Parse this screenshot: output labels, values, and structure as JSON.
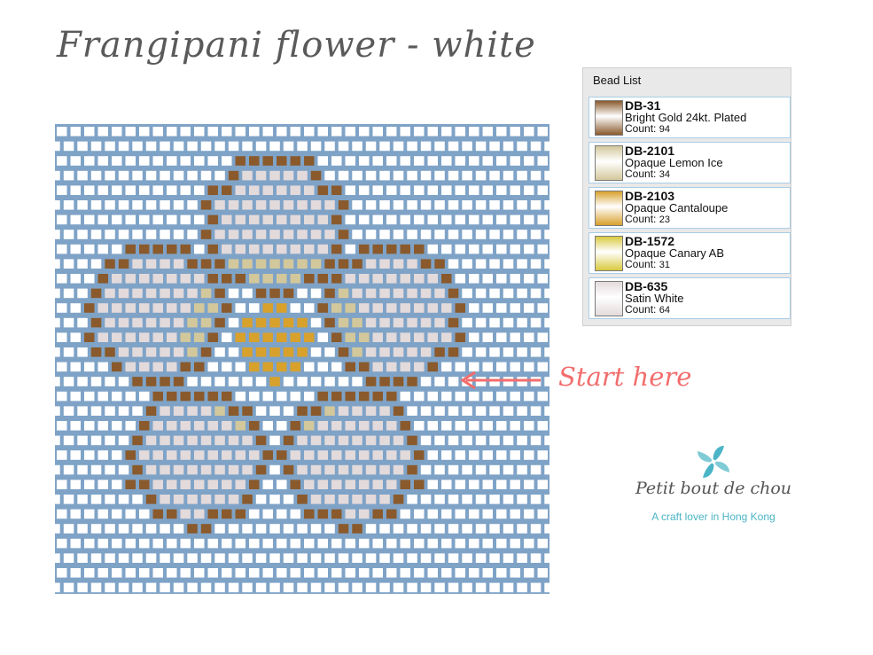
{
  "title": "Frangipani flower - white",
  "bead_list": {
    "header": "Bead List",
    "count_label": "Count:",
    "items": [
      {
        "code": "DB-31",
        "name": "Bright Gold 24kt. Plated",
        "count": "94",
        "color": "#8a5a2c"
      },
      {
        "code": "DB-2101",
        "name": "Opaque Lemon Ice",
        "count": "34",
        "color": "#d3c89b"
      },
      {
        "code": "DB-2103",
        "name": "Opaque Cantaloupe",
        "count": "23",
        "color": "#d8a12c"
      },
      {
        "code": "DB-1572",
        "name": "Opaque Canary AB",
        "count": "31",
        "color": "#d9c93e"
      },
      {
        "code": "DB-635",
        "name": "Satin White",
        "count": "64",
        "color": "#e3dadb"
      }
    ]
  },
  "annotation": {
    "label": "Start here",
    "color": "#f26d6d"
  },
  "logo": {
    "name": "Petit bout de chou",
    "tagline": "A craft lover in Hong Kong",
    "color": "#4bb4c6"
  },
  "pattern_colors": {
    "background": "#7fa3c7",
    "empty_bead": "#ffffff",
    "gold": "#8a5a2c",
    "lemon": "#d3c89b",
    "cantaloupe": "#d8a12c",
    "canary": "#d9c93e",
    "white": "#e3dadb"
  }
}
